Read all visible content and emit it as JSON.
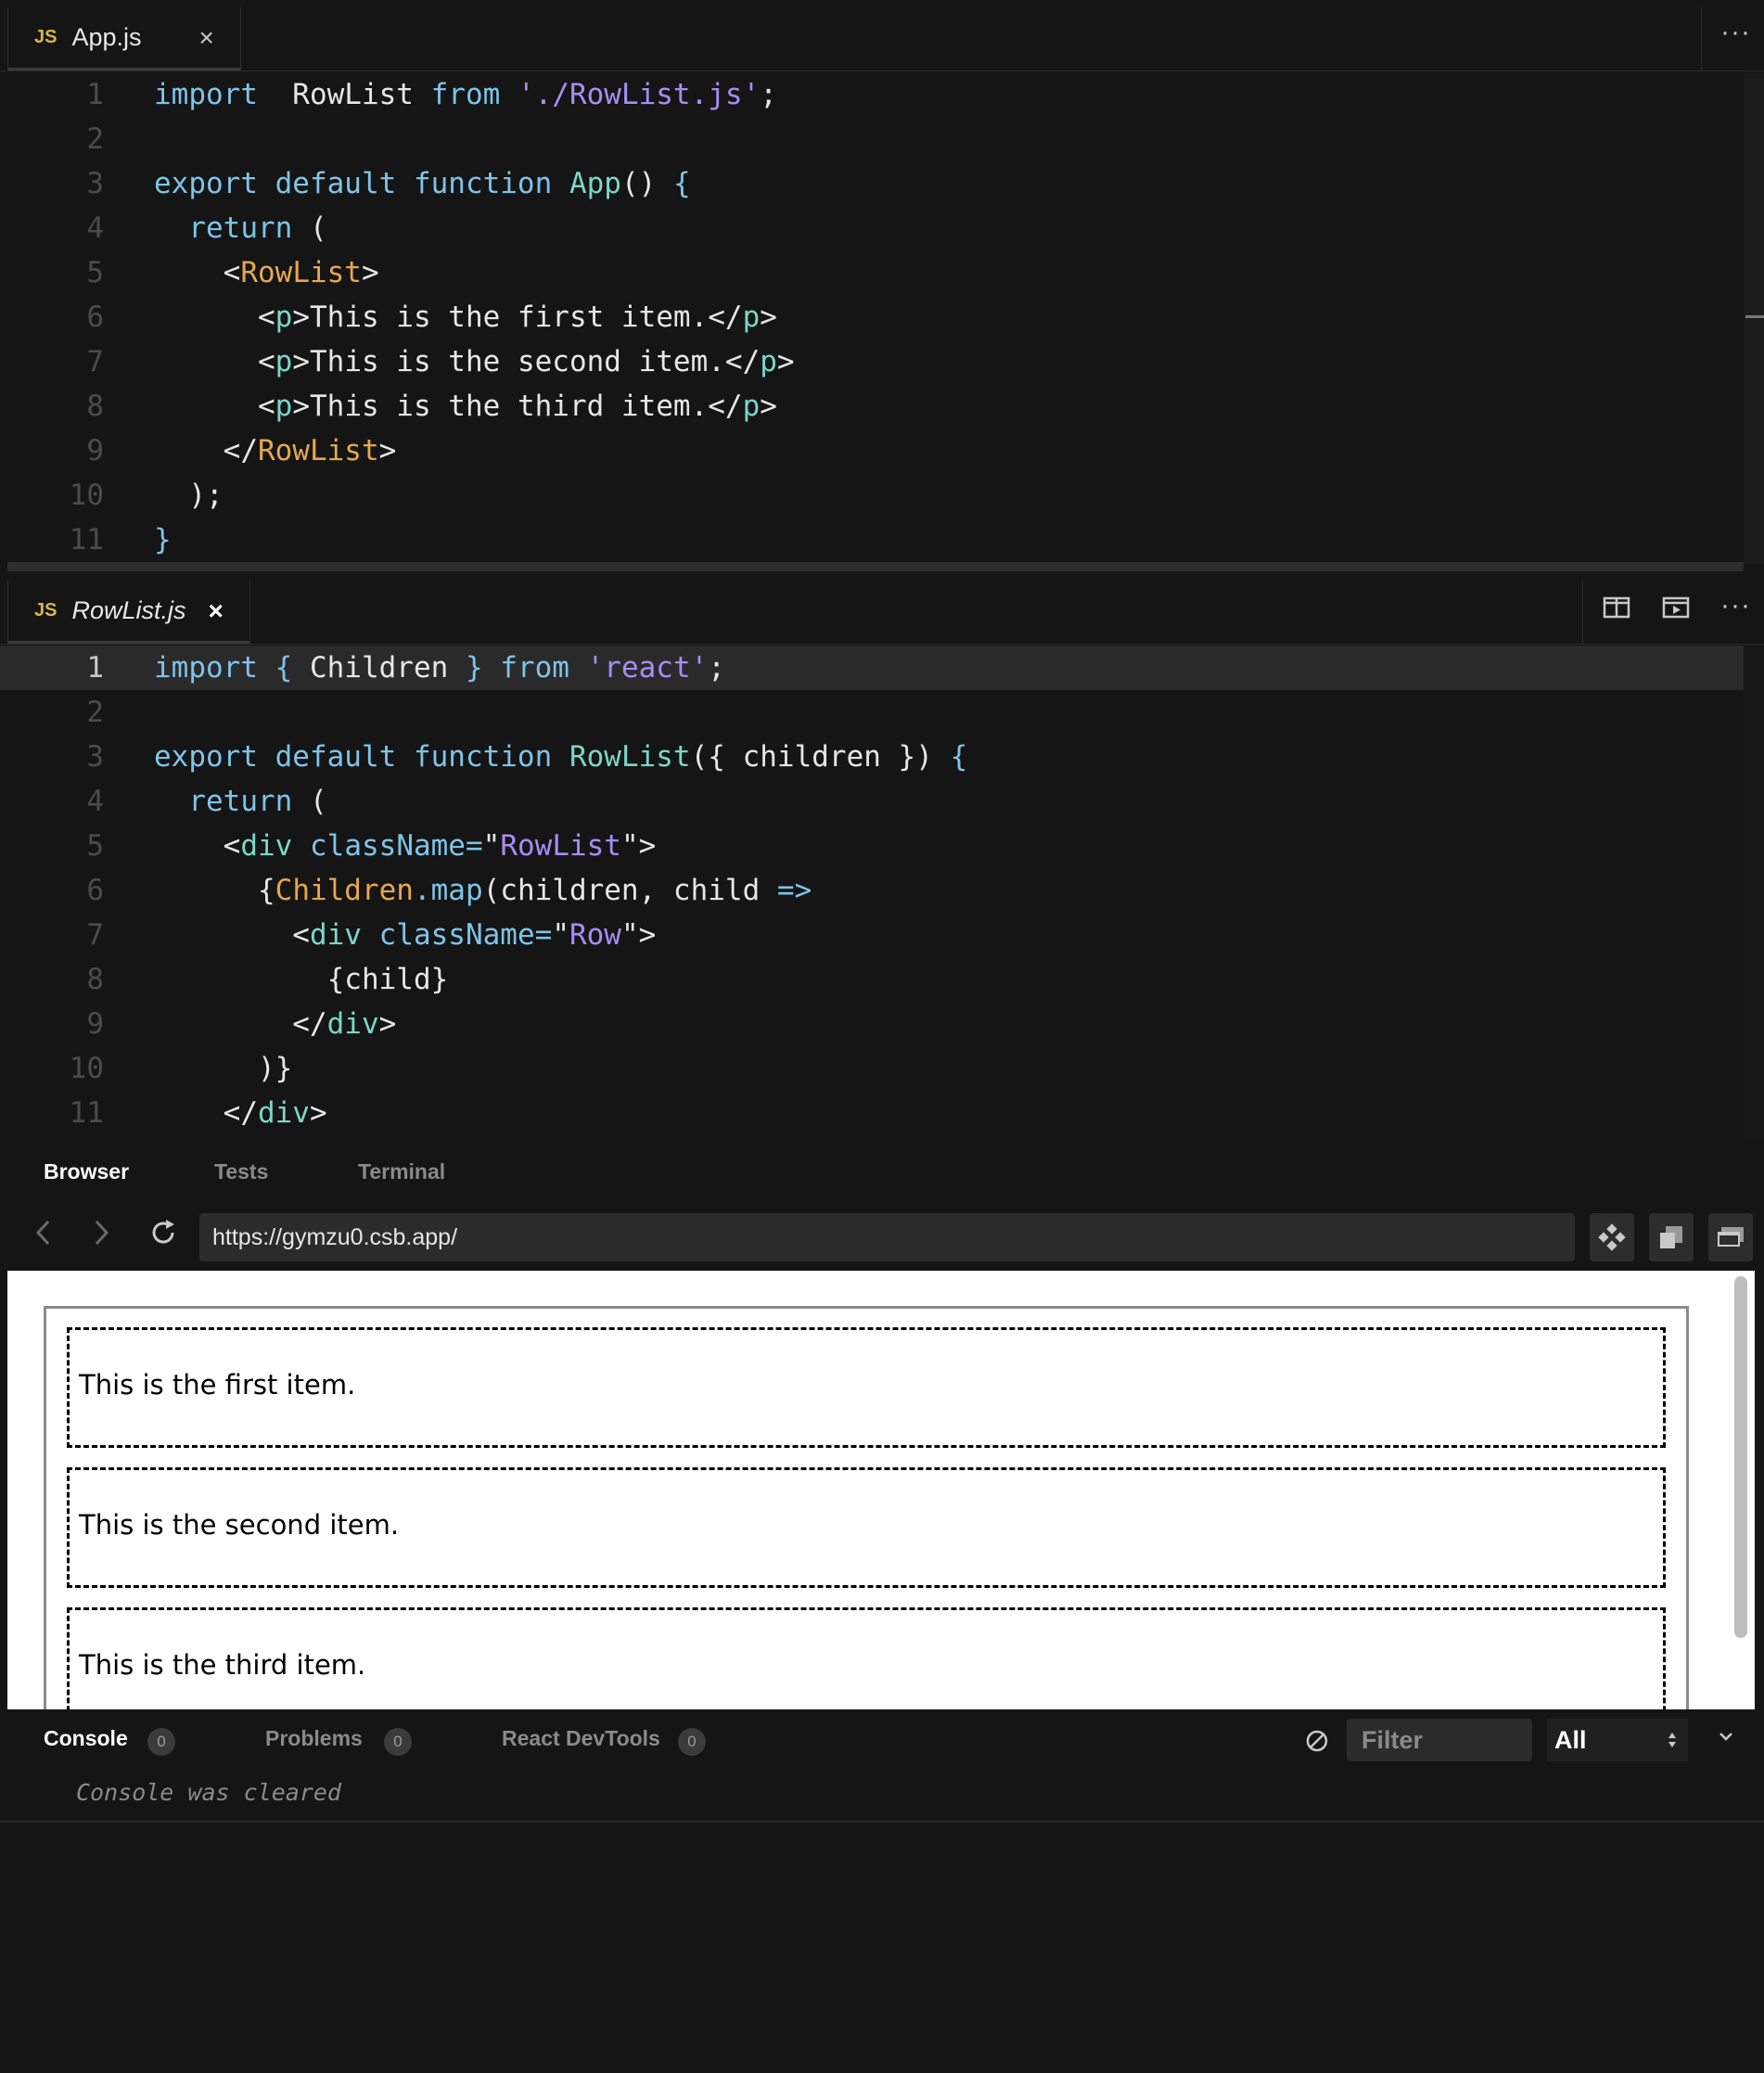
{
  "editor1": {
    "tab": {
      "badge": "JS",
      "name": "App.js",
      "close": "×"
    },
    "more": "···",
    "lines": [
      {
        "n": "1",
        "segs": [
          [
            "kw",
            "import"
          ],
          [
            "",
            "  RowList "
          ],
          [
            "kw",
            "from"
          ],
          [
            "",
            " "
          ],
          [
            "str",
            "'./RowList.js'"
          ],
          [
            "",
            ";"
          ]
        ]
      },
      {
        "n": "2",
        "segs": []
      },
      {
        "n": "3",
        "segs": [
          [
            "kw",
            "export default function"
          ],
          [
            "",
            " "
          ],
          [
            "fn",
            "App"
          ],
          [
            "",
            "() "
          ],
          [
            "kw",
            "{"
          ]
        ]
      },
      {
        "n": "4",
        "segs": [
          [
            "",
            "  "
          ],
          [
            "kw",
            "return"
          ],
          [
            "",
            " ("
          ]
        ]
      },
      {
        "n": "5",
        "segs": [
          [
            "",
            "    <"
          ],
          [
            "tag",
            "RowList"
          ],
          [
            "",
            ">"
          ]
        ]
      },
      {
        "n": "6",
        "segs": [
          [
            "",
            "      <"
          ],
          [
            "tg2",
            "p"
          ],
          [
            "",
            ">This is the first item.</"
          ],
          [
            "tg2",
            "p"
          ],
          [
            "",
            ">"
          ]
        ]
      },
      {
        "n": "7",
        "segs": [
          [
            "",
            "      <"
          ],
          [
            "tg2",
            "p"
          ],
          [
            "",
            ">This is the second item.</"
          ],
          [
            "tg2",
            "p"
          ],
          [
            "",
            ">"
          ]
        ]
      },
      {
        "n": "8",
        "segs": [
          [
            "",
            "      <"
          ],
          [
            "tg2",
            "p"
          ],
          [
            "",
            ">This is the third item.</"
          ],
          [
            "tg2",
            "p"
          ],
          [
            "",
            ">"
          ]
        ]
      },
      {
        "n": "9",
        "segs": [
          [
            "",
            "    </"
          ],
          [
            "tag",
            "RowList"
          ],
          [
            "",
            ">"
          ]
        ]
      },
      {
        "n": "10",
        "segs": [
          [
            "",
            "  );"
          ]
        ]
      },
      {
        "n": "11",
        "segs": [
          [
            "kw",
            "}"
          ]
        ]
      }
    ]
  },
  "editor2": {
    "tab": {
      "badge": "JS",
      "name": "RowList.js",
      "close": "×"
    },
    "more": "···",
    "lines": [
      {
        "n": "1",
        "segs": [
          [
            "kw",
            "import { "
          ],
          [
            "",
            "Children "
          ],
          [
            "kw",
            "} from"
          ],
          [
            "",
            " "
          ],
          [
            "str",
            "'react'"
          ],
          [
            "",
            ";"
          ]
        ]
      },
      {
        "n": "2",
        "segs": []
      },
      {
        "n": "3",
        "segs": [
          [
            "kw",
            "export default function"
          ],
          [
            "",
            " "
          ],
          [
            "fn",
            "RowList"
          ],
          [
            "",
            "({ children }) "
          ],
          [
            "kw",
            "{"
          ]
        ]
      },
      {
        "n": "4",
        "segs": [
          [
            "",
            "  "
          ],
          [
            "kw",
            "return"
          ],
          [
            "",
            " ("
          ]
        ]
      },
      {
        "n": "5",
        "segs": [
          [
            "",
            "    <"
          ],
          [
            "tg2",
            "div"
          ],
          [
            "",
            " "
          ],
          [
            "kw",
            "className"
          ],
          [
            "kw",
            "="
          ],
          [
            "",
            "\""
          ],
          [
            "str",
            "RowList"
          ],
          [
            "",
            "\">"
          ]
        ]
      },
      {
        "n": "6",
        "segs": [
          [
            "",
            "      {"
          ],
          [
            "tag",
            "Children"
          ],
          [
            "kw",
            ".map"
          ],
          [
            "",
            "(children, child "
          ],
          [
            "kw",
            "=>"
          ]
        ]
      },
      {
        "n": "7",
        "segs": [
          [
            "",
            "        <"
          ],
          [
            "tg2",
            "div"
          ],
          [
            "",
            " "
          ],
          [
            "kw",
            "className"
          ],
          [
            "kw",
            "="
          ],
          [
            "",
            "\""
          ],
          [
            "str",
            "Row"
          ],
          [
            "",
            "\">"
          ]
        ]
      },
      {
        "n": "8",
        "segs": [
          [
            "",
            "          {child}"
          ]
        ]
      },
      {
        "n": "9",
        "segs": [
          [
            "",
            "        </"
          ],
          [
            "tg2",
            "div"
          ],
          [
            "",
            ">"
          ]
        ]
      },
      {
        "n": "10",
        "segs": [
          [
            "",
            "      )}"
          ]
        ]
      },
      {
        "n": "11",
        "segs": [
          [
            "",
            "    </"
          ],
          [
            "tg2",
            "div"
          ],
          [
            "",
            ">"
          ]
        ]
      }
    ]
  },
  "browser": {
    "tabs": [
      "Browser",
      "Tests",
      "Terminal"
    ],
    "url": "https://gymzu0.csb.app/",
    "items": [
      "This is the first item.",
      "This is the second item.",
      "This is the third item."
    ]
  },
  "console": {
    "tabs": [
      {
        "label": "Console",
        "count": "0"
      },
      {
        "label": "Problems",
        "count": "0"
      },
      {
        "label": "React DevTools",
        "count": "0"
      }
    ],
    "filter_placeholder": "Filter",
    "level": "All",
    "message": "Console was cleared"
  }
}
